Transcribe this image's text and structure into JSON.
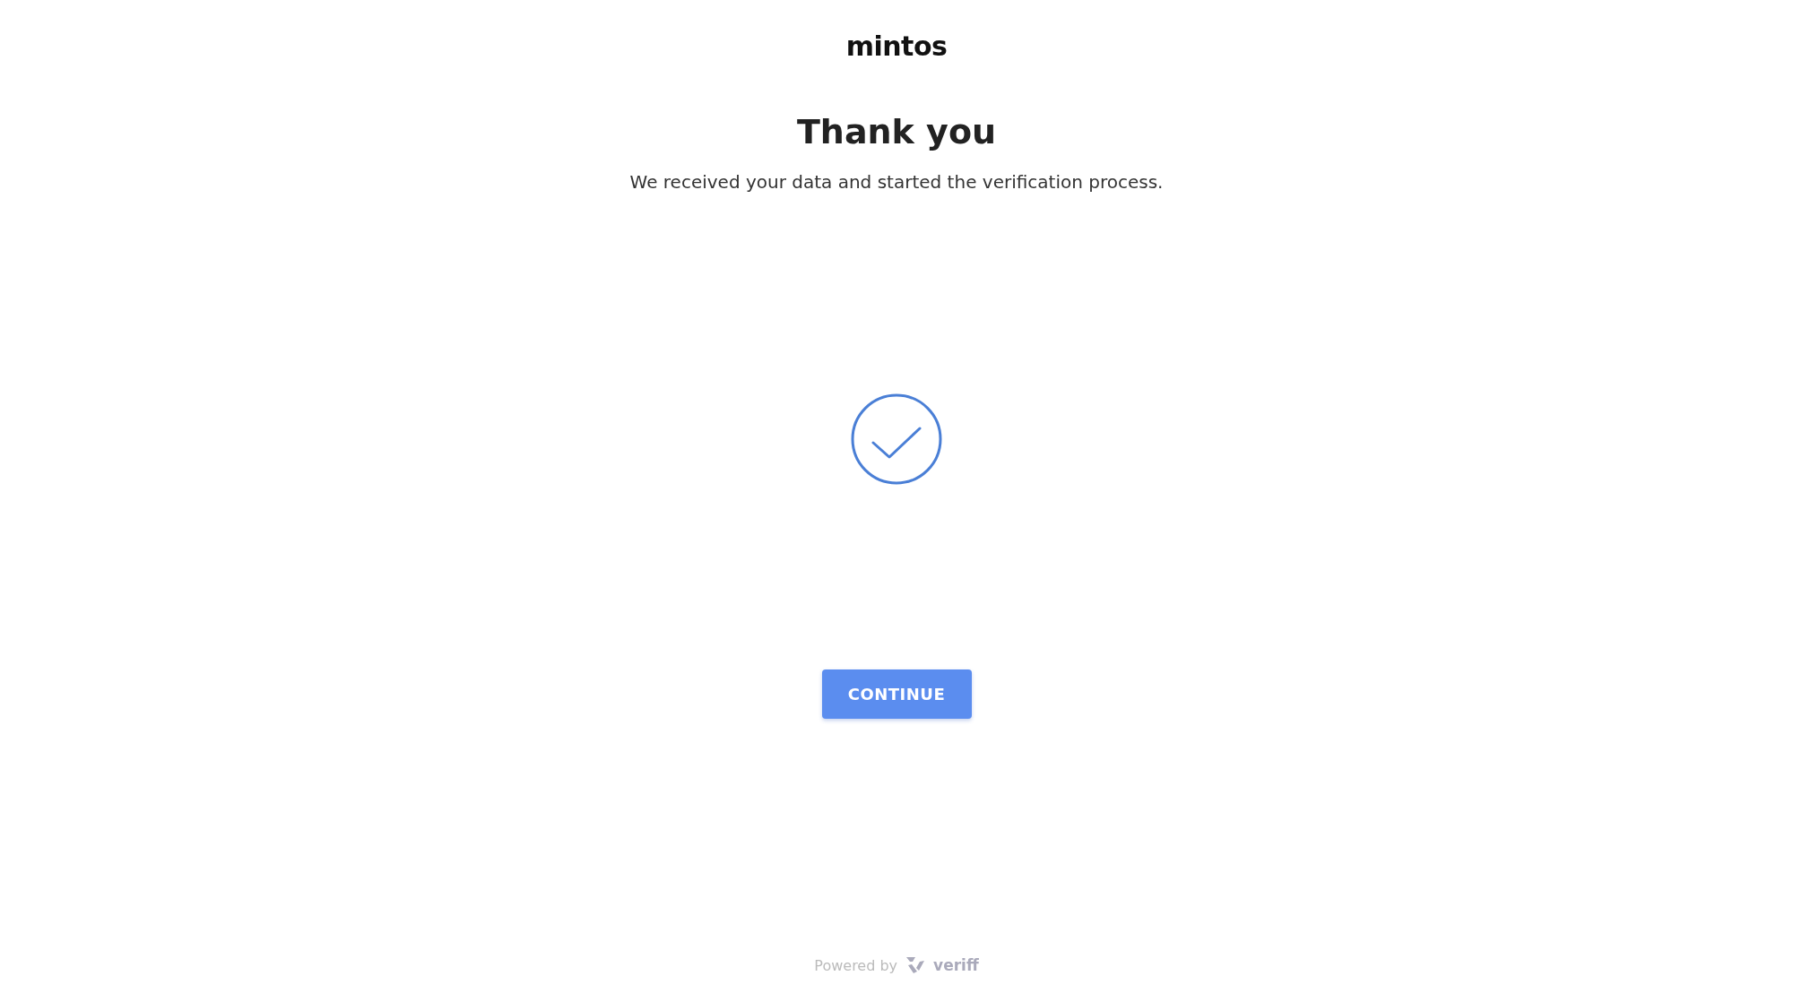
{
  "brand": {
    "logo": "mintos"
  },
  "heading": "Thank you",
  "message": "We received your data and started the verification process.",
  "button": {
    "label": "CONTINUE"
  },
  "footer": {
    "text": "Powered by",
    "brand": "veriff"
  }
}
